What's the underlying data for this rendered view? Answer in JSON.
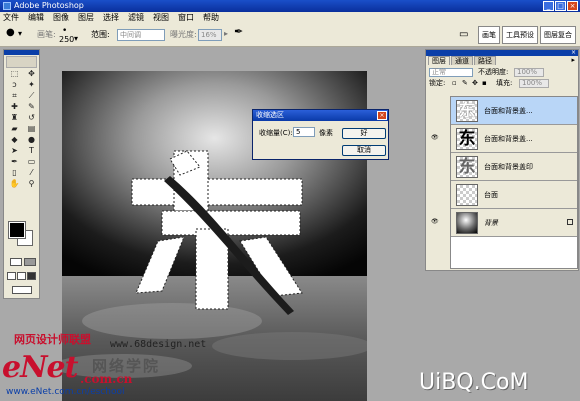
{
  "window": {
    "title": "Adobe Photoshop"
  },
  "menu": [
    "文件",
    "编辑",
    "图像",
    "图层",
    "选择",
    "滤镜",
    "视图",
    "窗口",
    "帮助"
  ],
  "options": {
    "mode_label": "画笔:",
    "brush_size": "250",
    "range_label": "范围:",
    "range_value": "中间调",
    "exposure_label": "曝光度:",
    "exposure_value": "16%"
  },
  "palette_well": [
    "画笔",
    "工具预设",
    "图层复合"
  ],
  "dialog": {
    "title": "收缩选区",
    "contract_label": "收缩量(C):",
    "contract_value": "5",
    "unit": "像素",
    "ok_label": "好",
    "cancel_label": "取消"
  },
  "layers_panel": {
    "tabs": [
      "图层",
      "通道",
      "路径"
    ],
    "blend_mode": "正常",
    "opacity_label": "不透明度:",
    "opacity_value": "100%",
    "lock_label": "锁定:",
    "fill_label": "填充:",
    "fill_value": "100%",
    "layers": [
      {
        "name": "台面和背景盖...",
        "selected": true,
        "thumb": "selected-text",
        "visible": false
      },
      {
        "name": "台面和背景盖...",
        "selected": false,
        "thumb": "text-black",
        "visible": true
      },
      {
        "name": "台面和背景盖印",
        "selected": false,
        "thumb": "text-gray",
        "visible": false
      },
      {
        "name": "台面",
        "selected": false,
        "thumb": "checker",
        "visible": false
      },
      {
        "name": "背景",
        "selected": false,
        "thumb": "gradient",
        "visible": true,
        "locked": true
      }
    ]
  },
  "canvas": {
    "glyph": "东"
  },
  "watermarks": {
    "site_cn": "网页设计师联盟",
    "site_url": "www.68design.net",
    "enet_logo": "eNet",
    "enet_domain": ".com.cn",
    "enet_cn": "网络学院",
    "enet_url": "www.eNet.com.cn/eschool",
    "uibq": "UiBQ.CoM"
  },
  "colors": {
    "foreground": "#000000",
    "background": "#ffffff",
    "selection": "#b9d6f7",
    "title_blue": "#0a3ea8"
  }
}
